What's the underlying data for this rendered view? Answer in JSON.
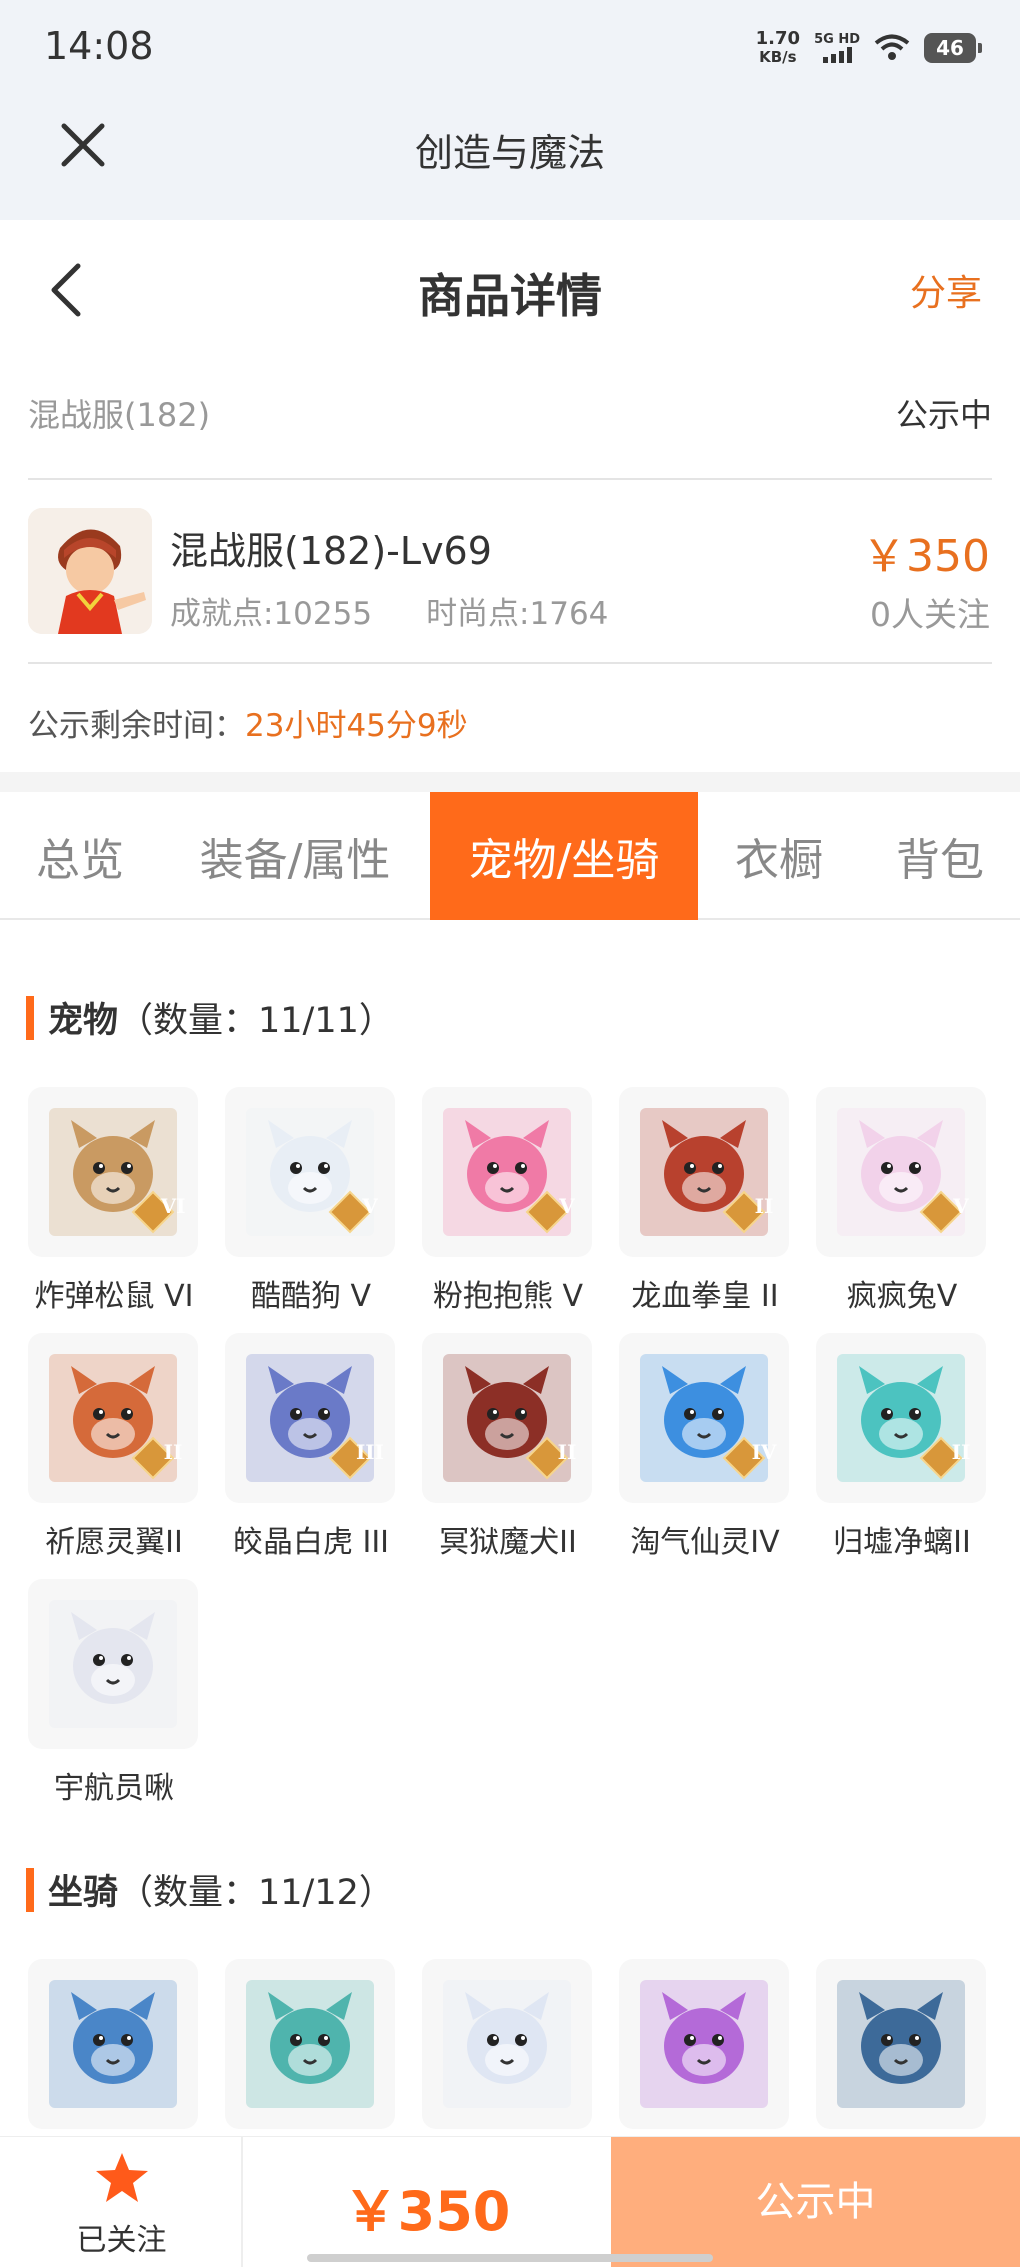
{
  "status": {
    "time": "14:08",
    "speed": "1.70",
    "speed_unit": "KB/s",
    "network": "5G HD",
    "battery": "46"
  },
  "app": {
    "title": "创造与魔法"
  },
  "header": {
    "title": "商品详情",
    "share": "分享"
  },
  "listing": {
    "server": "混战服(182)",
    "status": "公示中",
    "character_name": "混战服(182)-Lv69",
    "achievement": "成就点:10255",
    "fashion": "时尚点:1764",
    "price": "￥350",
    "followers": "0人关注",
    "remaining_label": "公示剩余时间：",
    "remaining_value": "23小时45分9秒"
  },
  "tabs": [
    "总览",
    "装备/属性",
    "宠物/坐骑",
    "衣橱",
    "背包"
  ],
  "active_tab": "宠物/坐骑",
  "pets": {
    "title": "宠物",
    "count": "（数量：11/11）",
    "items": [
      {
        "name": "炸弹松鼠 VI",
        "badge": "VI",
        "color": "#c99a62",
        "icon": "squirrel-icon"
      },
      {
        "name": "酷酷狗 V",
        "badge": "V",
        "color": "#e8eef5",
        "icon": "dog-icon"
      },
      {
        "name": "粉抱抱熊 V",
        "badge": "V",
        "color": "#f07aa6",
        "icon": "bear-icon"
      },
      {
        "name": "龙血拳皇 II",
        "badge": "II",
        "color": "#b8412e",
        "icon": "demon-icon"
      },
      {
        "name": "疯疯兔V",
        "badge": "V",
        "color": "#f2d2ea",
        "icon": "rabbit-icon"
      },
      {
        "name": "祈愿灵翼II",
        "badge": "II",
        "color": "#d56a3a",
        "icon": "griffin-icon"
      },
      {
        "name": "皎晶白虎 III",
        "badge": "III",
        "color": "#6a7ac8",
        "icon": "tiger-icon"
      },
      {
        "name": "冥狱魔犬II",
        "badge": "II",
        "color": "#8c2f26",
        "icon": "hellhound-icon"
      },
      {
        "name": "淘气仙灵IV",
        "badge": "IV",
        "color": "#3d8fe0",
        "icon": "sprite-icon"
      },
      {
        "name": "归墟净螭II",
        "badge": "II",
        "color": "#4cc3c0",
        "icon": "water-dragon-icon"
      },
      {
        "name": "宇航员啾",
        "badge": "",
        "color": "#e4e6ef",
        "icon": "astronaut-icon"
      }
    ]
  },
  "mounts": {
    "title": "坐骑",
    "count": "（数量：11/12）",
    "items": [
      {
        "name": "",
        "color": "#4a86c8",
        "icon": "blue-dragon-icon"
      },
      {
        "name": "",
        "color": "#4fb4ad",
        "icon": "serpent-icon"
      },
      {
        "name": "",
        "color": "#dfe6f3",
        "icon": "cloud-girl-icon"
      },
      {
        "name": "",
        "color": "#b46ad8",
        "icon": "heart-portal-icon"
      },
      {
        "name": "",
        "color": "#3d6a99",
        "icon": "dark-dragon-icon"
      }
    ]
  },
  "bottom": {
    "follow_label": "已关注",
    "price": "￥350",
    "action": "公示中"
  }
}
